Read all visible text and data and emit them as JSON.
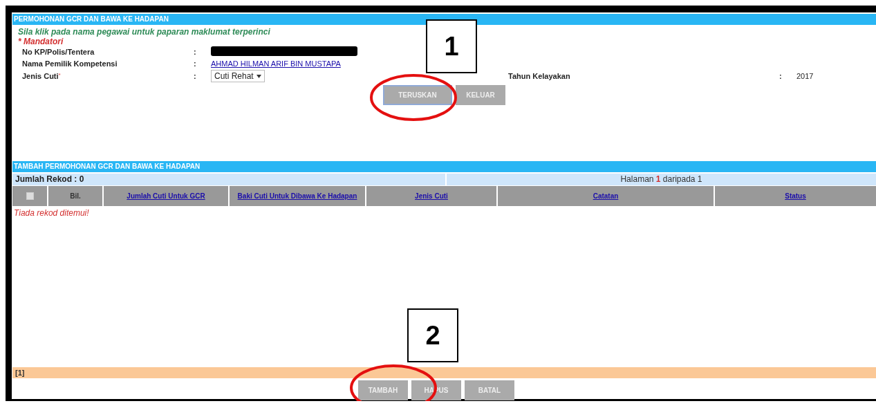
{
  "form_panel": {
    "title": "PERMOHONAN GCR DAN BAWA KE HADAPAN",
    "instruction": "Sila klik pada nama pegawai untuk paparan maklumat terperinci",
    "mandatory_note": "* Mandatori",
    "fields": [
      {
        "label": "No KP/Polis/Tentera",
        "separator": ":",
        "kind": "redacted"
      },
      {
        "label": "Nama Pemilik Kompetensi",
        "separator": ":",
        "kind": "link",
        "value": "AHMAD HILMAN ARIF BIN MUSTAPA"
      },
      {
        "label": "Jenis Cuti",
        "required_mark": "*",
        "separator": ":",
        "kind": "select",
        "value": "Cuti Rehat"
      }
    ],
    "side_field": {
      "label": "Tahun Kelayakan",
      "separator": ":",
      "value": "2017"
    },
    "buttons": [
      {
        "label": "TERUSKAN",
        "focused": true
      },
      {
        "label": "KELUAR",
        "focused": false
      }
    ]
  },
  "list_panel": {
    "title": "TAMBAH PERMOHONAN GCR DAN BAWA KE HADAPAN",
    "record_count": "Jumlah Rekod : 0",
    "paging": "Halaman **1** daripada 1",
    "table": {
      "select_all_checked": false,
      "columns": [
        {
          "label": "Bil.",
          "link": false
        },
        {
          "label": "Jumlah Cuti Untuk GCR",
          "link": true
        },
        {
          "label": "Baki Cuti Untuk Dibawa Ke Hadapan",
          "link": true
        },
        {
          "label": "Jenis Cuti",
          "link": true
        },
        {
          "label": "Catatan",
          "link": true
        },
        {
          "label": "Status",
          "link": true
        }
      ],
      "empty_message": "Tiada rekod ditemui!"
    },
    "pager": "[1]",
    "buttons": [
      {
        "label": "TAMBAH",
        "focused": false
      },
      {
        "label": "HAPUS",
        "focused": false
      },
      {
        "label": "BATAL",
        "focused": false
      }
    ]
  },
  "callouts": [
    {
      "label": "1"
    },
    {
      "label": "2"
    }
  ]
}
